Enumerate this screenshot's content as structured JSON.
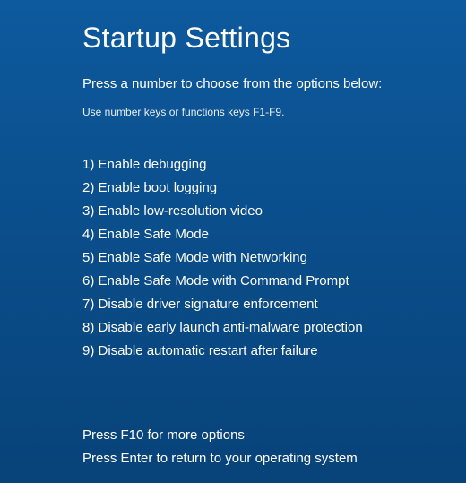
{
  "title": "Startup Settings",
  "subtitle": "Press a number to choose from the options below:",
  "hint": "Use number keys or functions keys F1-F9.",
  "options": [
    {
      "number": "1)",
      "label": "Enable debugging"
    },
    {
      "number": "2)",
      "label": "Enable boot logging"
    },
    {
      "number": "3)",
      "label": "Enable low-resolution video"
    },
    {
      "number": "4)",
      "label": "Enable Safe Mode"
    },
    {
      "number": "5)",
      "label": "Enable Safe Mode with Networking"
    },
    {
      "number": "6)",
      "label": "Enable Safe Mode with Command Prompt"
    },
    {
      "number": "7)",
      "label": "Disable driver signature enforcement"
    },
    {
      "number": "8)",
      "label": "Disable early launch anti-malware protection"
    },
    {
      "number": "9)",
      "label": "Disable automatic restart after failure"
    }
  ],
  "footer": {
    "more_options": "Press F10 for more options",
    "return_line": "Press Enter to return to your operating system"
  }
}
